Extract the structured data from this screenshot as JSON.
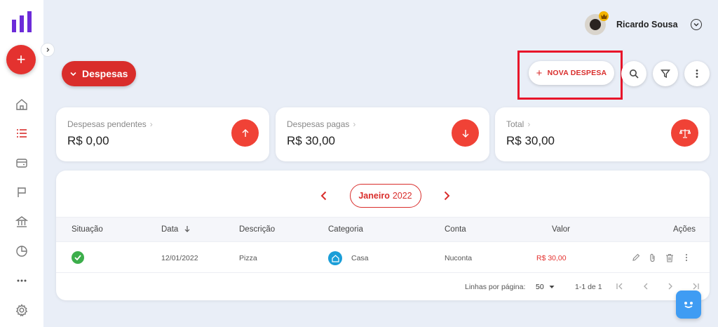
{
  "user": {
    "name": "Ricardo Sousa"
  },
  "page": {
    "title": "Despesas"
  },
  "toolbar": {
    "new_expense_label": "NOVA DESPESA"
  },
  "cards": [
    {
      "label": "Despesas pendentes",
      "value": "R$ 0,00",
      "icon": "arrow-up-icon"
    },
    {
      "label": "Despesas pagas",
      "value": "R$ 30,00",
      "icon": "arrow-down-icon"
    },
    {
      "label": "Total",
      "value": "R$ 30,00",
      "icon": "balance-scale-icon"
    }
  ],
  "month_nav": {
    "month": "Janeiro",
    "year": "2022"
  },
  "table": {
    "headers": {
      "situacao": "Situação",
      "data": "Data",
      "descricao": "Descrição",
      "categoria": "Categoria",
      "conta": "Conta",
      "valor": "Valor",
      "acoes": "Ações"
    },
    "rows": [
      {
        "data": "12/01/2022",
        "descricao": "Pizza",
        "categoria": "Casa",
        "conta": "Nuconta",
        "valor": "R$ 30,00"
      }
    ]
  },
  "pagination": {
    "rows_label": "Linhas por página:",
    "rows_value": "50",
    "range": "1-1 de 1"
  },
  "colors": {
    "accent": "#d92d2b",
    "card_icon": "#f04236",
    "sidebar_accent": "#6c2bd9",
    "paid": "#3cae4b",
    "category": "#1a9ed8"
  }
}
